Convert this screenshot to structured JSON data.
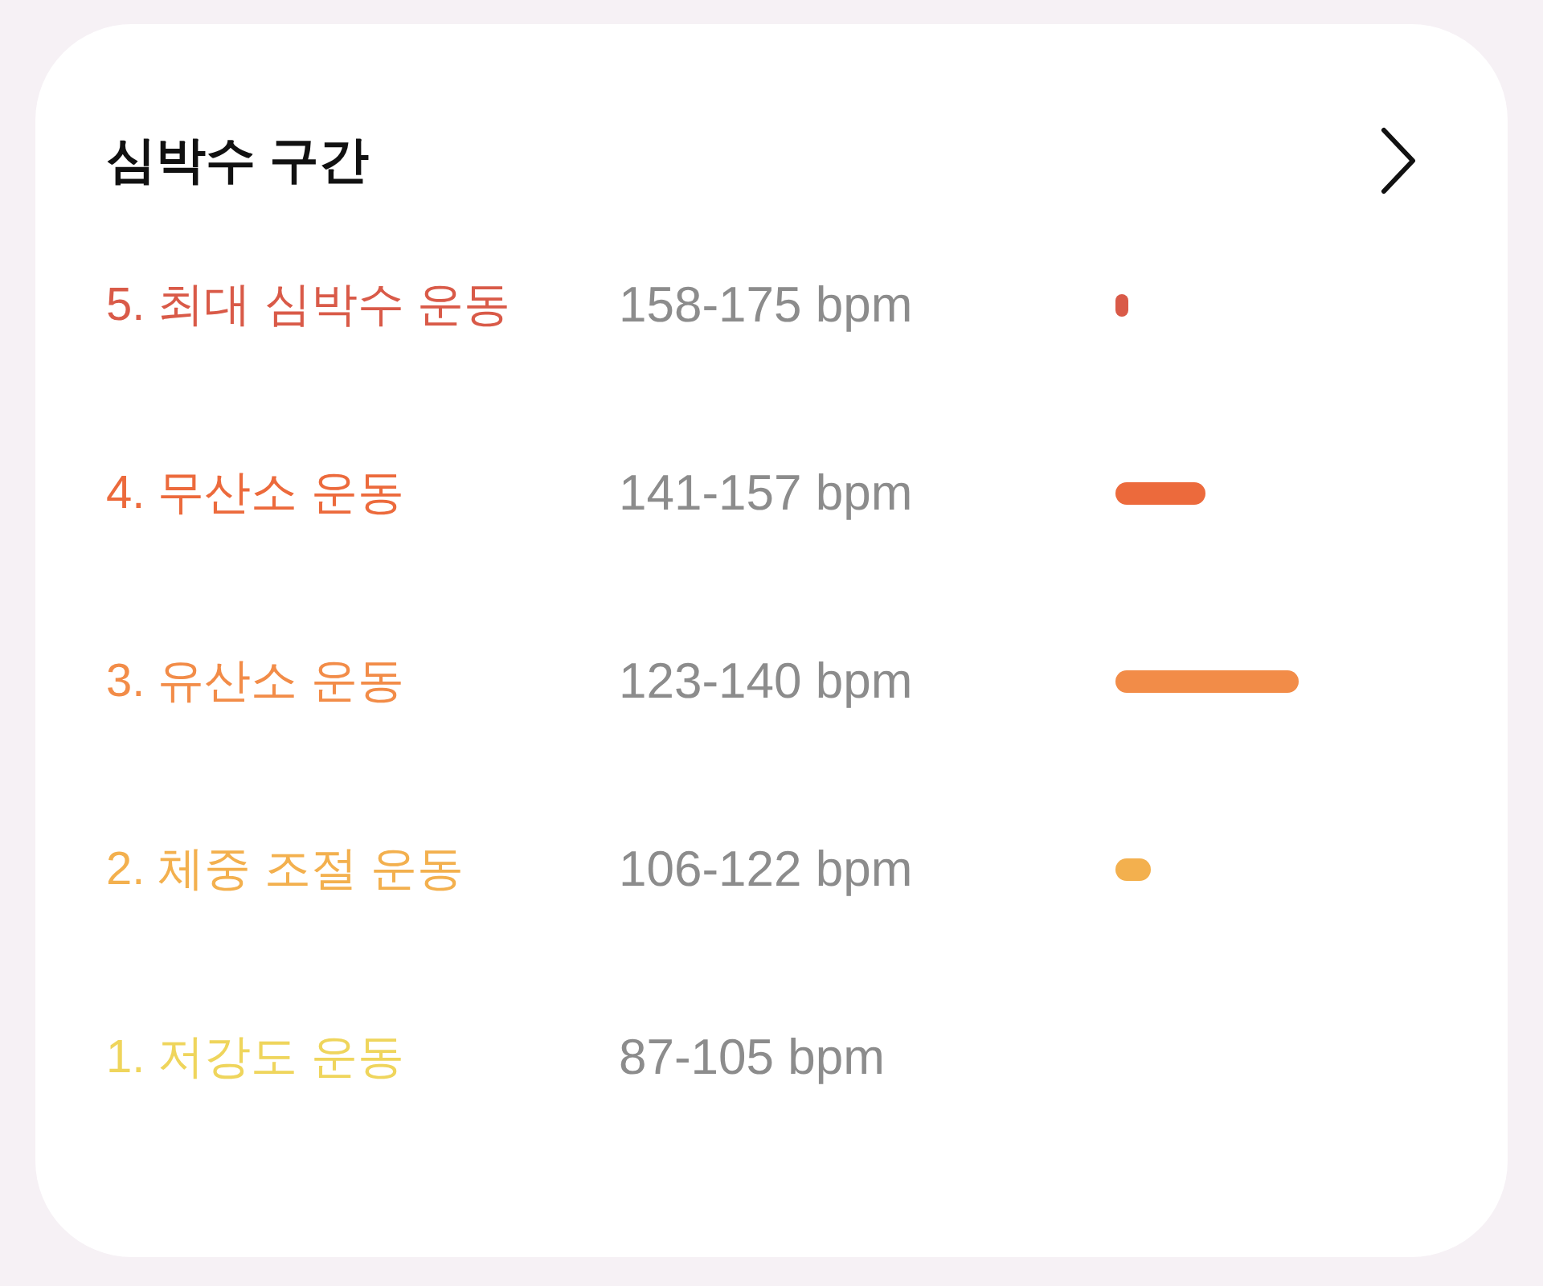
{
  "card": {
    "title": "심박수 구간"
  },
  "zones": [
    {
      "label": "5. 최대 심박수 운동",
      "range": "158-175 bpm",
      "color": "#d95a48"
    },
    {
      "label": "4. 무산소 운동",
      "range": "141-157 bpm",
      "color": "#ec6a3c"
    },
    {
      "label": "3. 유산소 운동",
      "range": "123-140 bpm",
      "color": "#f28c48"
    },
    {
      "label": "2. 체중 조절 운동",
      "range": "106-122 bpm",
      "color": "#f3b04e"
    },
    {
      "label": "1. 저강도 운동",
      "range": "87-105 bpm",
      "color": "#efd55c"
    }
  ]
}
